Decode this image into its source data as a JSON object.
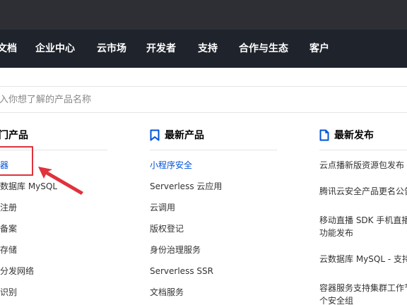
{
  "nav": {
    "items": [
      "文档",
      "企业中心",
      "云市场",
      "开发者",
      "支持",
      "合作与生态",
      "客户"
    ]
  },
  "search": {
    "placeholder": "输入你想了解的产品名称"
  },
  "columns": {
    "hot": {
      "title": "热门产品",
      "items": [
        "服务器",
        "云数据库 MySQL",
        "域名注册",
        "网站备案",
        "对象存储",
        "内容分发网络",
        "文字识别"
      ]
    },
    "new_products": {
      "title": "最新产品",
      "items": [
        "小程序安全",
        "Serverless 云应用",
        "云调用",
        "版权登记",
        "身份治理服务",
        "Serverless SSR",
        "文档服务"
      ]
    },
    "releases": {
      "title": "最新发布",
      "items": [
        "云点播新版资源包发布",
        "腾讯云安全产品更名公告",
        "移动直播 SDK 手机直播",
        "功能发布",
        "云数据库 MySQL - 支持",
        "容器服务支持集群工作节",
        "个安全组"
      ]
    }
  },
  "colors": {
    "nav_bg": "#1f232c",
    "top_bg": "#2d2f34",
    "link_blue": "#0052d9",
    "annotation_red": "#e0323c"
  }
}
